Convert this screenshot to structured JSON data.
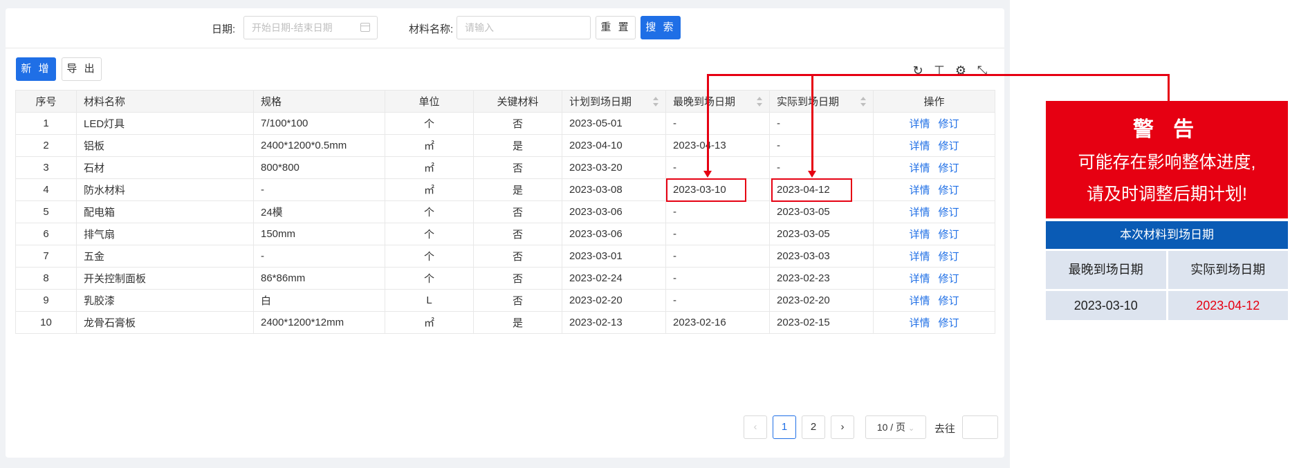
{
  "search": {
    "date_label": "日期:",
    "date_placeholder": "开始日期-结束日期",
    "name_label": "材料名称:",
    "name_placeholder": "请输入",
    "reset_label": "重 置",
    "search_label": "搜 索"
  },
  "toolbar": {
    "add_label": "新 增",
    "export_label": "导 出",
    "icons": [
      "refresh-icon",
      "column-height-icon",
      "settings-icon",
      "fullscreen-icon"
    ]
  },
  "table": {
    "columns": [
      "序号",
      "材料名称",
      "规格",
      "单位",
      "关键材料",
      "计划到场日期",
      "最晚到场日期",
      "实际到场日期",
      "操作"
    ],
    "rows": [
      {
        "no": "1",
        "name": "LED灯具",
        "spec": "7/100*100",
        "unit": "个",
        "key": "否",
        "planned": "2023-05-01",
        "latest": "-",
        "actual": "-"
      },
      {
        "no": "2",
        "name": "铝板",
        "spec": "2400*1200*0.5mm",
        "unit": "㎡",
        "key": "是",
        "planned": "2023-04-10",
        "latest": "2023-04-13",
        "actual": "-"
      },
      {
        "no": "3",
        "name": "石材",
        "spec": "800*800",
        "unit": "㎡",
        "key": "否",
        "planned": "2023-03-20",
        "latest": "-",
        "actual": "-"
      },
      {
        "no": "4",
        "name": "防水材料",
        "spec": "-",
        "unit": "㎡",
        "key": "是",
        "planned": "2023-03-08",
        "latest": "2023-03-10",
        "actual": "2023-04-12"
      },
      {
        "no": "5",
        "name": "配电箱",
        "spec": "24模",
        "unit": "个",
        "key": "否",
        "planned": "2023-03-06",
        "latest": "-",
        "actual": "2023-03-05"
      },
      {
        "no": "6",
        "name": "排气扇",
        "spec": "150mm",
        "unit": "个",
        "key": "否",
        "planned": "2023-03-06",
        "latest": "-",
        "actual": "2023-03-05"
      },
      {
        "no": "7",
        "name": "五金",
        "spec": "-",
        "unit": "个",
        "key": "否",
        "planned": "2023-03-01",
        "latest": "-",
        "actual": "2023-03-03"
      },
      {
        "no": "8",
        "name": "开关控制面板",
        "spec": "86*86mm",
        "unit": "个",
        "key": "否",
        "planned": "2023-02-24",
        "latest": "-",
        "actual": "2023-02-23"
      },
      {
        "no": "9",
        "name": "乳胶漆",
        "spec": "白",
        "unit": "L",
        "key": "否",
        "planned": "2023-02-20",
        "latest": "-",
        "actual": "2023-02-20"
      },
      {
        "no": "10",
        "name": "龙骨石膏板",
        "spec": "2400*1200*12mm",
        "unit": "㎡",
        "key": "是",
        "planned": "2023-02-13",
        "latest": "2023-02-16",
        "actual": "2023-02-15"
      }
    ],
    "action_detail": "详情",
    "action_revise": "修订"
  },
  "pagination": {
    "pages": [
      "1",
      "2"
    ],
    "current": "1",
    "page_size": "10 / 页",
    "goto_label": "去往"
  },
  "warning": {
    "title": "警 告",
    "line1": "可能存在影响整体进度,",
    "line2": "请及时调整后期计划!"
  },
  "info_panel": {
    "header": "本次材料到场日期",
    "latest_label": "最晚到场日期",
    "actual_label": "实际到场日期",
    "latest_value": "2023-03-10",
    "actual_value": "2023-04-12"
  },
  "colors": {
    "primary": "#1f6fe6",
    "alert_red": "#e60012",
    "late_red": "#ff4d4f",
    "key_orange": "#f5a623",
    "panel_blue": "#0a5bb5"
  }
}
